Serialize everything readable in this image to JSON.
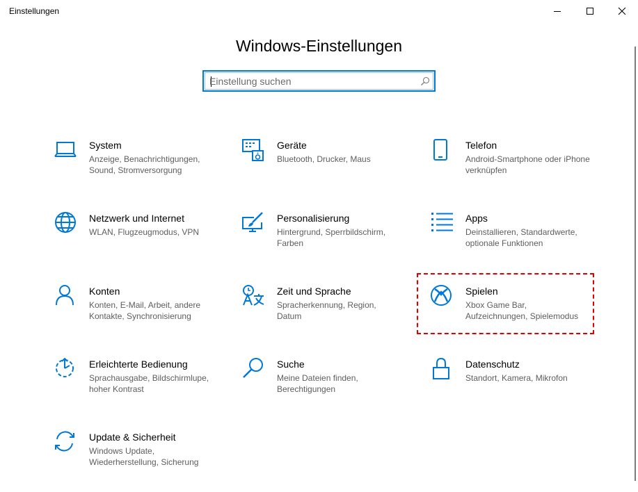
{
  "window": {
    "title": "Einstellungen"
  },
  "page": {
    "title": "Windows-Einstellungen"
  },
  "search": {
    "placeholder": "Einstellung suchen"
  },
  "colors": {
    "accent": "#0078d7",
    "highlight": "#e00000",
    "description": "#5d5d5d"
  },
  "tiles": [
    {
      "title": "System",
      "description": "Anzeige, Benachrichtigungen, Sound, Stromversorgung",
      "icon": "laptop-icon"
    },
    {
      "title": "Geräte",
      "description": "Bluetooth, Drucker, Maus",
      "icon": "devices-icon"
    },
    {
      "title": "Telefon",
      "description": "Android-Smartphone oder iPhone verknüpfen",
      "icon": "phone-icon"
    },
    {
      "title": "Netzwerk und Internet",
      "description": "WLAN, Flugzeugmodus, VPN",
      "icon": "globe-icon"
    },
    {
      "title": "Personalisierung",
      "description": "Hintergrund, Sperrbildschirm, Farben",
      "icon": "personalization-icon"
    },
    {
      "title": "Apps",
      "description": "Deinstallieren, Standardwerte, optionale Funktionen",
      "icon": "apps-list-icon"
    },
    {
      "title": "Konten",
      "description": "Konten, E-Mail, Arbeit, andere Kontakte, Synchronisierung",
      "icon": "person-icon"
    },
    {
      "title": "Zeit und Sprache",
      "description": "Spracherkennung, Region, Datum",
      "icon": "time-language-icon"
    },
    {
      "title": "Spielen",
      "description": "Xbox Game Bar, Aufzeichnungen, Spielemodus",
      "icon": "xbox-icon"
    },
    {
      "title": "Erleichterte Bedienung",
      "description": "Sprachausgabe, Bildschirmlupe, hoher Kontrast",
      "icon": "ease-of-access-icon"
    },
    {
      "title": "Suche",
      "description": "Meine Dateien finden, Berechtigungen",
      "icon": "search-magnifier-icon"
    },
    {
      "title": "Datenschutz",
      "description": "Standort, Kamera, Mikrofon",
      "icon": "lock-icon"
    },
    {
      "title": "Update & Sicherheit",
      "description": "Windows Update, Wiederherstellung, Sicherung",
      "icon": "update-icon"
    }
  ]
}
